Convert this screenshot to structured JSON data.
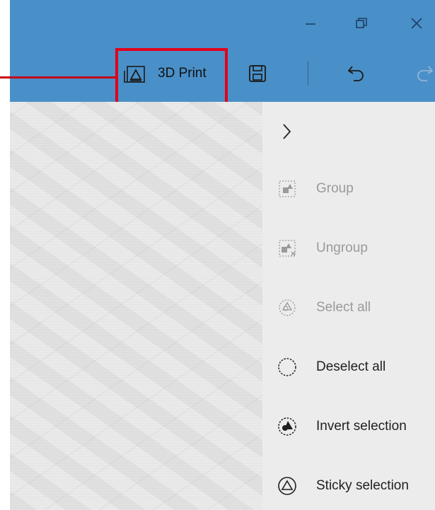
{
  "window": {
    "controls": [
      "minimize",
      "restore",
      "close"
    ]
  },
  "toolbar": {
    "print3d_label": "3D Print",
    "icons": [
      "3d-print-icon",
      "save-icon",
      "undo-icon",
      "redo-icon"
    ]
  },
  "panel": {
    "expand_icon": "chevron-right-icon",
    "items": [
      {
        "label": "Group",
        "icon": "group-icon",
        "enabled": false
      },
      {
        "label": "Ungroup",
        "icon": "ungroup-icon",
        "enabled": false
      },
      {
        "label": "Select all",
        "icon": "select-all-icon",
        "enabled": false
      },
      {
        "label": "Deselect all",
        "icon": "deselect-all-icon",
        "enabled": true
      },
      {
        "label": "Invert selection",
        "icon": "invert-selection-icon",
        "enabled": true
      },
      {
        "label": "Sticky selection",
        "icon": "sticky-selection-icon",
        "enabled": true
      }
    ]
  },
  "colors": {
    "titlebar": "#4a90c8",
    "highlight": "#e2001a",
    "panel": "#ececec",
    "disabled_text": "#9a9a9a"
  }
}
